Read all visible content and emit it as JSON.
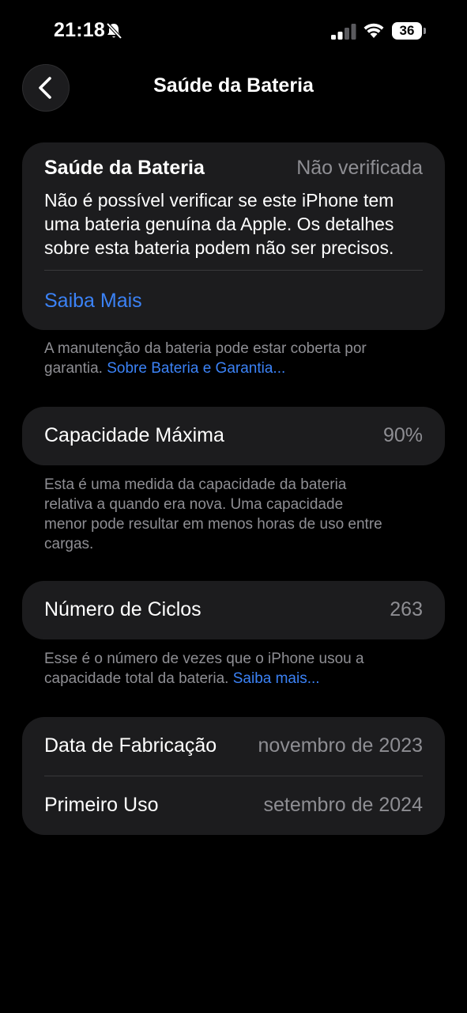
{
  "status_bar": {
    "time": "21:18",
    "battery_level": "36"
  },
  "nav": {
    "title": "Saúde da Bateria"
  },
  "health_card": {
    "label": "Saúde da Bateria",
    "value": "Não verificada",
    "description_lines": [
      "Não é possível verificar se este iPhone tem",
      "uma bateria genuína da Apple. Os detalhes",
      "sobre esta bateria podem não ser precisos."
    ],
    "learn_more": "Saiba Mais"
  },
  "warranty_note": {
    "text_line1": "A manutenção da bateria pode estar coberta por",
    "text_line2": "garantia. ",
    "link": "Sobre Bateria e Garantia..."
  },
  "capacity": {
    "label": "Capacidade Máxima",
    "value": "90%",
    "note_lines": [
      "Esta é uma medida da capacidade da bateria",
      "relativa a quando era nova. Uma capacidade",
      "menor pode resultar em menos horas de uso entre",
      "cargas."
    ]
  },
  "cycles": {
    "label": "Número de Ciclos",
    "value": "263",
    "note_line1": "Esse é o número de vezes que o iPhone usou a",
    "note_line2": "capacidade total da bateria. ",
    "note_link": "Saiba mais..."
  },
  "dates": {
    "manufacture_label": "Data de Fabricação",
    "manufacture_value": "novembro de 2023",
    "first_use_label": "Primeiro Uso",
    "first_use_value": "setembro de 2024"
  },
  "colors": {
    "background": "#000000",
    "card": "#1c1c1e",
    "secondary_text": "#8e8e93",
    "link": "#3b82f6"
  }
}
